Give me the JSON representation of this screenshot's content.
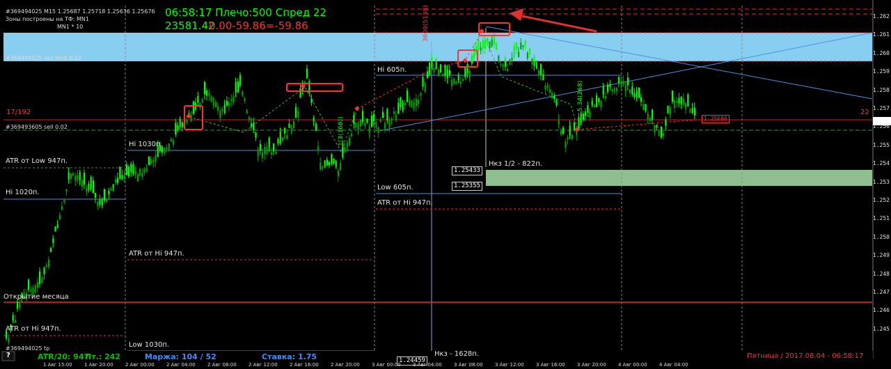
{
  "header": {
    "symbol_line": "#369494025 M15  1.25687 1.25718 1.25636 1.25676",
    "zones_line": "Зоны построены на ТФ: MN1",
    "mn_line": "MN1 * 10",
    "order_line": "#369494025 sell limit 0.02",
    "clock_line": "06:58:17 Плечо:500 Спред 22",
    "equity_line": "23581.42",
    "pl_line": "0.00-59.86=-59.86"
  },
  "orders": {
    "sell_limit": "#369494025 sell limit 0.02",
    "sell": "#369493605 sell 0.02",
    "tp": "#369494025 tp"
  },
  "levels": {
    "hi_605": "Hi 605п.",
    "hi_1030": "Hi 1030п.",
    "atr_low_947": "ATR от Low 947п.",
    "hi_1020": "Hi 1020п.",
    "low_605": "Low 605п.",
    "atr_hi_947_a": "ATR от Hi 947п.",
    "atr_hi_947_b": "ATR от Hi 947п.",
    "atr_hi_947_c": "ATR от Hi 947п.",
    "open_month": "Открытие месяца",
    "low_1030": "Low 1030п.",
    "nkz_half": "Нкз 1/2 - 822п.",
    "nkz": "Нкз - 1628п.",
    "counter": "17/192",
    "counter_right": "22"
  },
  "price_boxes": {
    "p1": "1.25433",
    "p2": "1.25355",
    "p3": "1.24459",
    "current": "1.25690"
  },
  "price_axis": [
    "1.262",
    "1.261",
    "1.260",
    "1.259",
    "1.258",
    "1.257",
    "1.256",
    "1.255",
    "1.254",
    "1.253",
    "1.252",
    "1.251",
    "1.250",
    "1.249",
    "1.248",
    "1.247",
    "1.246",
    "1.245"
  ],
  "time_axis": [
    "1 Авг 15:00",
    "1 Авг 20:00",
    "2 Авг 00:00",
    "2 Авг 04:00",
    "2 Авг 08:00",
    "2 Авг 12:00",
    "2 Авг 16:00",
    "2 Авг 20:00",
    "3 Авг 00:00",
    "3 Авг 04:00",
    "3 Авг 08:00",
    "3 Авг 12:00",
    "3 Авг 16:00",
    "3 Авг 20:00",
    "4 Авг 00:00",
    "4 Авг 04:00"
  ],
  "status_bar": {
    "question": "?",
    "atr": "ATR/20: 947",
    "pt": "Пт.: 242",
    "margin": "Маржа: 104 / 52",
    "rate": "Ставка: 1.75",
    "datetime": "Пятница / 2017.08.04 - 06:58:17"
  },
  "vertical_labels": {
    "v1": "3600(5138)",
    "v2": "1(3(368))",
    "v3": "5.34(268)"
  },
  "colors": {
    "candle_up": "#00ff00",
    "candle_down": "#00a000",
    "zone_blue": "#87cef0",
    "zone_green": "#8fbf8f",
    "level_blue": "#4a90e2",
    "level_red": "#ff2020",
    "header_green": "#00ff00",
    "header_red": "#ff3030"
  }
}
